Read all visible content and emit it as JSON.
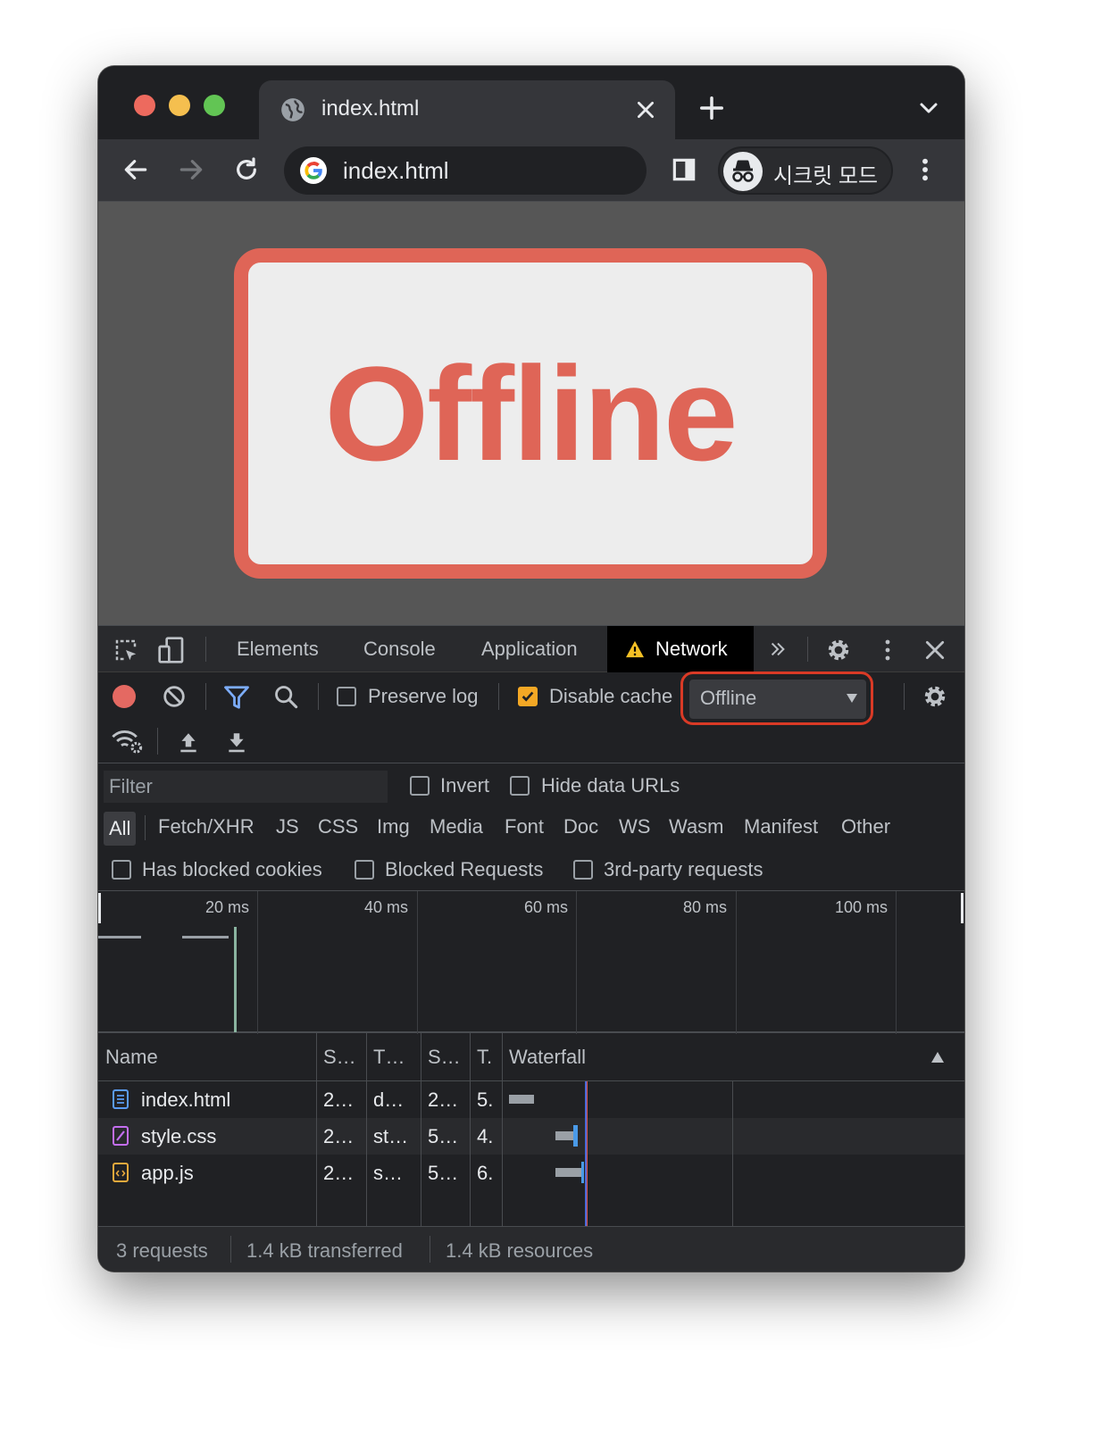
{
  "browser": {
    "tab_title": "index.html",
    "omnibox_text": "index.html",
    "profile_label": "시크릿 모드",
    "colors": {
      "traffic_red": "#ed6a5e",
      "traffic_yellow": "#f5bf4f",
      "traffic_green": "#62c554"
    }
  },
  "page": {
    "heading": "Offline",
    "accent_color": "#df6557"
  },
  "devtools": {
    "tabs": [
      {
        "label": "Elements"
      },
      {
        "label": "Console"
      },
      {
        "label": "Application"
      },
      {
        "label": "Network",
        "active": true,
        "warning": true
      }
    ],
    "toolbar": {
      "preserve_log_label": "Preserve log",
      "preserve_log_checked": false,
      "disable_cache_label": "Disable cache",
      "disable_cache_checked": true,
      "throttling_value": "Offline"
    },
    "filter": {
      "placeholder": "Filter",
      "invert_label": "Invert",
      "hide_data_urls_label": "Hide data URLs"
    },
    "type_filters": [
      "All",
      "Fetch/XHR",
      "JS",
      "CSS",
      "Img",
      "Media",
      "Font",
      "Doc",
      "WS",
      "Wasm",
      "Manifest",
      "Other"
    ],
    "extra_filters": {
      "blocked_cookies": "Has blocked cookies",
      "blocked_requests": "Blocked Requests",
      "third_party": "3rd-party requests"
    },
    "overview_ticks": [
      "20 ms",
      "40 ms",
      "60 ms",
      "80 ms",
      "100 ms"
    ],
    "table": {
      "headers": [
        "Name",
        "S…",
        "T…",
        "S…",
        "T.",
        "Waterfall"
      ],
      "rows": [
        {
          "name": "index.html",
          "status": "2…",
          "type": "d…",
          "size": "2…",
          "time": "5.",
          "icon": "document-icon"
        },
        {
          "name": "style.css",
          "status": "2…",
          "type": "st…",
          "size": "5…",
          "time": "4.",
          "icon": "stylesheet-icon"
        },
        {
          "name": "app.js",
          "status": "2…",
          "type": "s…",
          "size": "5…",
          "time": "6.",
          "icon": "script-icon"
        }
      ]
    },
    "status": {
      "requests": "3 requests",
      "transferred": "1.4 kB transferred",
      "resources": "1.4 kB resources"
    }
  }
}
